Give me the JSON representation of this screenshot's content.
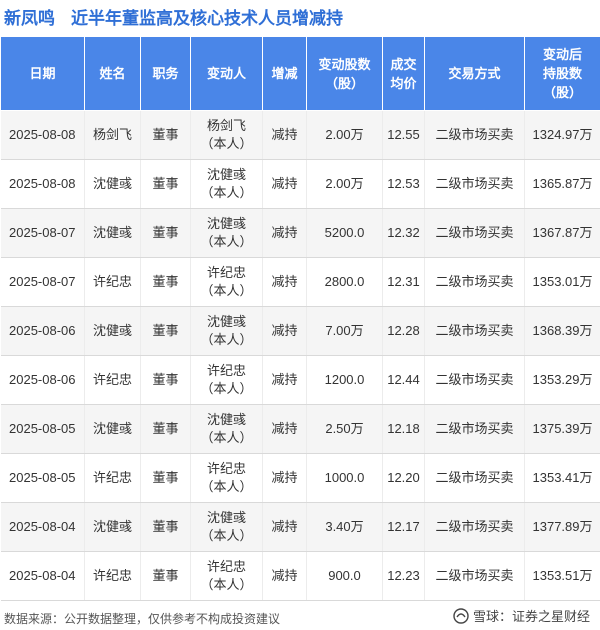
{
  "title": {
    "company": "新凤鸣",
    "main": "近半年董监高及核心技术人员增减持"
  },
  "table": {
    "headers": [
      [
        "日期"
      ],
      [
        "姓名"
      ],
      [
        "职务"
      ],
      [
        "变动人"
      ],
      [
        "增减"
      ],
      [
        "变动股数",
        "（股）"
      ],
      [
        "成交",
        "均价"
      ],
      [
        "交易方式"
      ],
      [
        "变动后",
        "持股数",
        "（股）"
      ]
    ],
    "rows": [
      {
        "date": "2025-08-08",
        "name": "杨剑飞",
        "position": "董事",
        "changer": [
          "杨剑飞",
          "（本人）"
        ],
        "direction": "减持",
        "shares": "2.00万",
        "price": "12.55",
        "method": "二级市场买卖",
        "after": "1324.97万"
      },
      {
        "date": "2025-08-08",
        "name": "沈健彧",
        "position": "董事",
        "changer": [
          "沈健彧",
          "（本人）"
        ],
        "direction": "减持",
        "shares": "2.00万",
        "price": "12.53",
        "method": "二级市场买卖",
        "after": "1365.87万"
      },
      {
        "date": "2025-08-07",
        "name": "沈健彧",
        "position": "董事",
        "changer": [
          "沈健彧",
          "（本人）"
        ],
        "direction": "减持",
        "shares": "5200.0",
        "price": "12.32",
        "method": "二级市场买卖",
        "after": "1367.87万"
      },
      {
        "date": "2025-08-07",
        "name": "许纪忠",
        "position": "董事",
        "changer": [
          "许纪忠",
          "（本人）"
        ],
        "direction": "减持",
        "shares": "2800.0",
        "price": "12.31",
        "method": "二级市场买卖",
        "after": "1353.01万"
      },
      {
        "date": "2025-08-06",
        "name": "沈健彧",
        "position": "董事",
        "changer": [
          "沈健彧",
          "（本人）"
        ],
        "direction": "减持",
        "shares": "7.00万",
        "price": "12.28",
        "method": "二级市场买卖",
        "after": "1368.39万"
      },
      {
        "date": "2025-08-06",
        "name": "许纪忠",
        "position": "董事",
        "changer": [
          "许纪忠",
          "（本人）"
        ],
        "direction": "减持",
        "shares": "1200.0",
        "price": "12.44",
        "method": "二级市场买卖",
        "after": "1353.29万"
      },
      {
        "date": "2025-08-05",
        "name": "沈健彧",
        "position": "董事",
        "changer": [
          "沈健彧",
          "（本人）"
        ],
        "direction": "减持",
        "shares": "2.50万",
        "price": "12.18",
        "method": "二级市场买卖",
        "after": "1375.39万"
      },
      {
        "date": "2025-08-05",
        "name": "许纪忠",
        "position": "董事",
        "changer": [
          "许纪忠",
          "（本人）"
        ],
        "direction": "减持",
        "shares": "1000.0",
        "price": "12.20",
        "method": "二级市场买卖",
        "after": "1353.41万"
      },
      {
        "date": "2025-08-04",
        "name": "沈健彧",
        "position": "董事",
        "changer": [
          "沈健彧",
          "（本人）"
        ],
        "direction": "减持",
        "shares": "3.40万",
        "price": "12.17",
        "method": "二级市场买卖",
        "after": "1377.89万"
      },
      {
        "date": "2025-08-04",
        "name": "许纪忠",
        "position": "董事",
        "changer": [
          "许纪忠",
          "（本人）"
        ],
        "direction": "减持",
        "shares": "900.0",
        "price": "12.23",
        "method": "二级市场买卖",
        "after": "1353.51万"
      }
    ]
  },
  "footer": {
    "source": "数据来源：公开数据整理，仅供参考不构成投资建议",
    "brand": "雪球：证券之星财经"
  },
  "watermark": "证券之星",
  "colors": {
    "header_bg": "#4a86e8",
    "title": "#2f6fd6",
    "decrease": "#2aa12e",
    "row_alt": "#f5f5f5"
  }
}
